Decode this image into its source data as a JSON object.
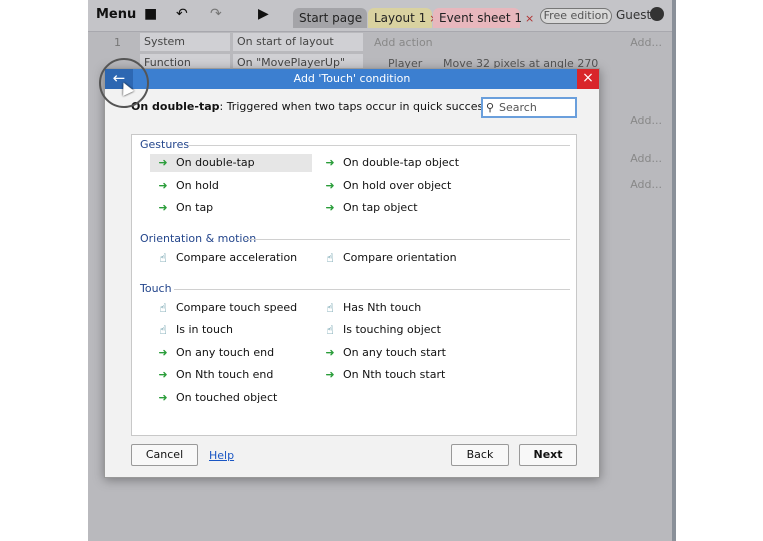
{
  "toolbar": {
    "menu_label": "Menu",
    "tabs": [
      {
        "label": "Start page"
      },
      {
        "label": "Layout 1",
        "close": "×"
      },
      {
        "label": "Event sheet 1",
        "close": "×"
      }
    ],
    "free_edition": "Free edition",
    "guest": "Guest"
  },
  "event_sheet": {
    "rows": [
      {
        "num": "1",
        "object": "System",
        "condition": "On start of layout",
        "action": "Add action",
        "add": "Add..."
      },
      {
        "num": "",
        "object": "Function",
        "condition": "On \"MovePlayerUp\"",
        "action_obj": "Player",
        "action": "Move 32 pixels at angle 270",
        "add": ""
      }
    ],
    "side_adds": [
      "Add...",
      "Add...",
      "Add..."
    ]
  },
  "dialog": {
    "title": "Add 'Touch' condition",
    "back_symbol": "←",
    "close_symbol": "×",
    "desc_bold": "On double-tap",
    "desc_text": ": Triggered when two taps occur in quick succession.",
    "search_placeholder": "Search",
    "sections": [
      {
        "name": "Gestures",
        "items": [
          {
            "label": "On double-tap",
            "icon": "trigger-arrow-icon"
          },
          {
            "label": "On double-tap object",
            "icon": "trigger-arrow-icon"
          },
          {
            "label": "On hold",
            "icon": "trigger-arrow-icon"
          },
          {
            "label": "On hold over object",
            "icon": "trigger-arrow-icon"
          },
          {
            "label": "On tap",
            "icon": "trigger-arrow-icon"
          },
          {
            "label": "On tap object",
            "icon": "trigger-arrow-icon"
          }
        ]
      },
      {
        "name": "Orientation & motion",
        "items": [
          {
            "label": "Compare acceleration",
            "icon": "touch-icon"
          },
          {
            "label": "Compare orientation",
            "icon": "touch-icon"
          }
        ]
      },
      {
        "name": "Touch",
        "items": [
          {
            "label": "Compare touch speed",
            "icon": "touch-icon"
          },
          {
            "label": "Has Nth touch",
            "icon": "touch-icon"
          },
          {
            "label": "Is in touch",
            "icon": "touch-icon"
          },
          {
            "label": "Is touching object",
            "icon": "touch-icon"
          },
          {
            "label": "On any touch end",
            "icon": "trigger-arrow-icon"
          },
          {
            "label": "On any touch start",
            "icon": "trigger-arrow-icon"
          },
          {
            "label": "On Nth touch end",
            "icon": "trigger-arrow-icon"
          },
          {
            "label": "On Nth touch start",
            "icon": "trigger-arrow-icon"
          },
          {
            "label": "On touched object",
            "icon": "trigger-arrow-icon"
          }
        ]
      }
    ],
    "buttons": {
      "cancel": "Cancel",
      "help": "Help",
      "back": "Back",
      "next": "Next"
    }
  },
  "colors": {
    "title_bar": "#3c7fd0",
    "close": "#d9252a",
    "section": "#24468c",
    "trigger_arrow": "#2a9d3a",
    "touch_icon": "#1d6b7f"
  }
}
